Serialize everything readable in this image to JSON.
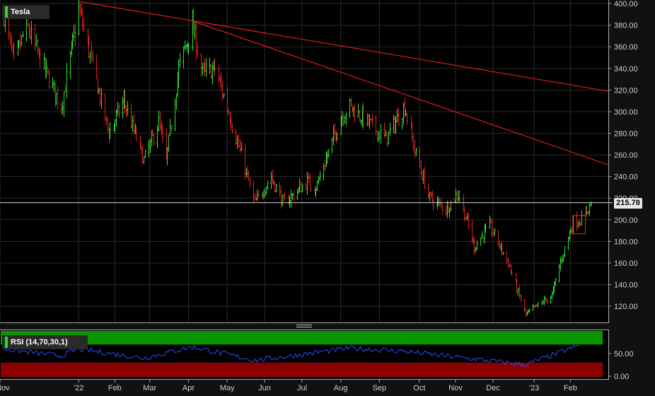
{
  "chart_data": [
    {
      "type": "ohlc",
      "title": "Tesla",
      "ylim": [
        105,
        402
      ],
      "y_ticks": [
        120,
        140,
        160,
        180,
        200,
        220,
        240,
        260,
        280,
        300,
        320,
        340,
        360,
        380,
        400
      ],
      "y_tick_labels": [
        "120.00",
        "140.00",
        "160.00",
        "180.00",
        "200.00",
        "220.00",
        "240.00",
        "260.00",
        "280.00",
        "300.00",
        "320.00",
        "340.00",
        "360.00",
        "380.00",
        "400.00"
      ],
      "x_tick_labels": [
        "Nov",
        "'22",
        "Feb",
        "Mar",
        "Apr",
        "May",
        "Jun",
        "Jul",
        "Aug",
        "Sep",
        "Oct",
        "Nov",
        "Dec",
        "'23",
        "Feb"
      ],
      "x_ticks": [
        "2021-11-01",
        "2022-01-03",
        "2022-02-01",
        "2022-03-01",
        "2022-04-01",
        "2022-05-02",
        "2022-06-01",
        "2022-07-01",
        "2022-08-01",
        "2022-09-01",
        "2022-10-03",
        "2022-11-01",
        "2022-12-01",
        "2023-01-03",
        "2023-02-01"
      ],
      "last_price": 215.78,
      "last_price_label": "215.78",
      "up_color": "#2ee02e",
      "down_color": "#e02020",
      "key_closes": [
        {
          "date": "2021-11-04",
          "close": 390
        },
        {
          "date": "2021-11-12",
          "close": 345
        },
        {
          "date": "2021-11-22",
          "close": 380
        },
        {
          "date": "2021-12-08",
          "close": 335
        },
        {
          "date": "2021-12-20",
          "close": 305
        },
        {
          "date": "2022-01-03",
          "close": 395
        },
        {
          "date": "2022-01-27",
          "close": 280
        },
        {
          "date": "2022-02-08",
          "close": 310
        },
        {
          "date": "2022-02-24",
          "close": 255
        },
        {
          "date": "2022-03-08",
          "close": 290
        },
        {
          "date": "2022-03-14",
          "close": 255
        },
        {
          "date": "2022-03-24",
          "close": 340
        },
        {
          "date": "2022-04-04",
          "close": 380
        },
        {
          "date": "2022-04-12",
          "close": 335
        },
        {
          "date": "2022-04-22",
          "close": 340
        },
        {
          "date": "2022-05-03",
          "close": 300
        },
        {
          "date": "2022-05-24",
          "close": 215
        },
        {
          "date": "2022-06-06",
          "close": 240
        },
        {
          "date": "2022-06-16",
          "close": 215
        },
        {
          "date": "2022-07-05",
          "close": 235
        },
        {
          "date": "2022-07-12",
          "close": 230
        },
        {
          "date": "2022-08-01",
          "close": 295
        },
        {
          "date": "2022-08-08",
          "close": 305
        },
        {
          "date": "2022-08-18",
          "close": 295
        },
        {
          "date": "2022-09-06",
          "close": 275
        },
        {
          "date": "2022-09-21",
          "close": 305
        },
        {
          "date": "2022-09-30",
          "close": 260
        },
        {
          "date": "2022-10-11",
          "close": 220
        },
        {
          "date": "2022-10-24",
          "close": 210
        },
        {
          "date": "2022-11-03",
          "close": 225
        },
        {
          "date": "2022-11-16",
          "close": 175
        },
        {
          "date": "2022-11-28",
          "close": 195
        },
        {
          "date": "2022-12-13",
          "close": 160
        },
        {
          "date": "2022-12-27",
          "close": 112
        },
        {
          "date": "2023-01-05",
          "close": 120
        },
        {
          "date": "2023-01-17",
          "close": 130
        },
        {
          "date": "2023-01-26",
          "close": 170
        },
        {
          "date": "2023-02-03",
          "close": 198
        },
        {
          "date": "2023-02-10",
          "close": 200
        },
        {
          "date": "2023-02-17",
          "close": 215
        }
      ],
      "trendlines": [
        {
          "start": {
            "date": "2022-01-03",
            "value": 402
          },
          "end": {
            "date": "2023-03-03",
            "value": 319
          },
          "color": "#ff2020"
        },
        {
          "start": {
            "date": "2022-04-04",
            "value": 384
          },
          "end": {
            "date": "2023-03-03",
            "value": 251
          },
          "color": "#ff2020"
        }
      ],
      "highlight_box": {
        "date_start": "2023-02-03",
        "date_end": "2023-02-13",
        "low": 187,
        "high": 204,
        "color": "#ff2020"
      }
    },
    {
      "type": "line",
      "title": "RSI (14,70,30,1)",
      "ylim": [
        0,
        100
      ],
      "y_ticks": [
        0,
        50
      ],
      "y_tick_labels": [
        "0.00",
        "50.00"
      ],
      "overbought": 70,
      "oversold": 30,
      "zone_colors": {
        "overbought": "#0a9400",
        "oversold": "#8b0000"
      },
      "line_color": "#2a4bff",
      "key_values": [
        {
          "date": "2021-11-04",
          "value": 60
        },
        {
          "date": "2021-12-20",
          "value": 45
        },
        {
          "date": "2022-01-03",
          "value": 60
        },
        {
          "date": "2022-02-24",
          "value": 40
        },
        {
          "date": "2022-04-04",
          "value": 65
        },
        {
          "date": "2022-05-24",
          "value": 35
        },
        {
          "date": "2022-08-08",
          "value": 62
        },
        {
          "date": "2022-09-21",
          "value": 55
        },
        {
          "date": "2022-11-16",
          "value": 38
        },
        {
          "date": "2022-12-27",
          "value": 25
        },
        {
          "date": "2023-02-10",
          "value": 70
        }
      ]
    }
  ]
}
